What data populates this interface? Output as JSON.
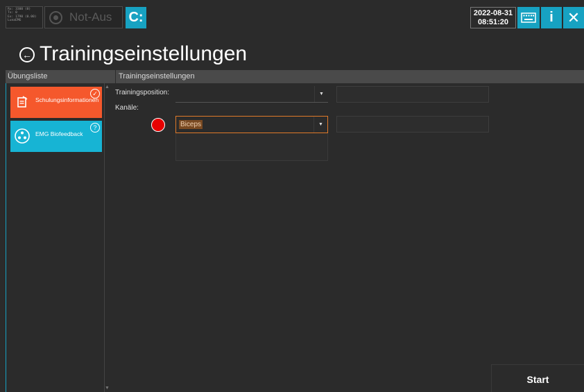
{
  "status": {
    "lines": [
      "Rx: 3300 (0)",
      "Tx: 0",
      "Ex: 1790 (0.00)",
      "LunaEMG"
    ]
  },
  "topbar": {
    "notaus_label": "Not-Aus",
    "connect_label": "C:",
    "date": "2022-08-31",
    "time": "08:51:20",
    "info_label": "i",
    "close_label": "✕"
  },
  "page": {
    "title": "Trainingseinstellungen"
  },
  "sections": {
    "left_header": "Übungsliste",
    "right_header": "Trainingseinstellungen"
  },
  "exercise_list": {
    "items": [
      {
        "label": "Schulungsinformationen",
        "badge": "✓",
        "color": "#f5582c"
      },
      {
        "label": "EMG Biofeedback",
        "badge": "?",
        "color": "#17b4d4"
      }
    ]
  },
  "settings": {
    "training_position_label": "Trainingsposition:",
    "training_position_value": "",
    "channels_label": "Kanäle:",
    "channel_1_value": "Biceps",
    "channel_1_color": "#e60000"
  },
  "actions": {
    "start_label": "Start"
  },
  "colors": {
    "accent": "#17a2c2",
    "background": "#2b2b2b"
  }
}
